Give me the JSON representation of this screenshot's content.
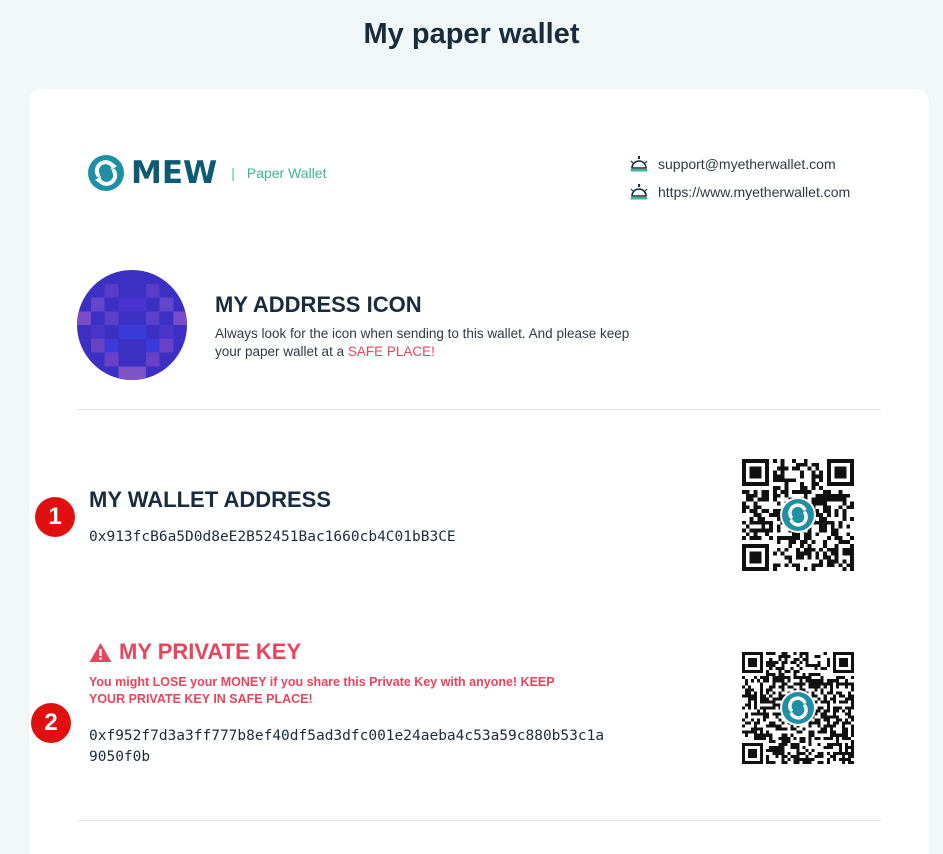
{
  "page": {
    "title": "My paper wallet"
  },
  "header": {
    "logo_text": "MEW",
    "separator": "|",
    "subtitle": "Paper Wallet",
    "contacts": [
      {
        "icon": "concierge-bell-icon",
        "text": "support@myetherwallet.com"
      },
      {
        "icon": "concierge-bell-icon",
        "text": "https://www.myetherwallet.com"
      }
    ]
  },
  "address_icon": {
    "title": "MY ADDRESS ICON",
    "description": "Always look for the icon when sending to this wallet. And please keep your paper wallet at a ",
    "highlight": "SAFE PLACE!"
  },
  "wallet_address": {
    "step": "1",
    "title": "MY WALLET ADDRESS",
    "value": "0x913fcB6a5D0d8eE2B52451Bac1660cb4C01bB3CE"
  },
  "private_key": {
    "step": "2",
    "title": "MY PRIVATE KEY",
    "warning": "You might LOSE your MONEY if you share this Private Key with anyone! KEEP YOUR PRIVATE KEY IN SAFE PLACE!",
    "value": "0xf952f7d3a3ff777b8ef40df5ad3dfc001e24aeba4c53a59c880b53c1a9050f0b"
  },
  "colors": {
    "brand": "#0d5b73",
    "accent": "#3fb39a",
    "danger": "#e9445d",
    "badge": "#e01010"
  }
}
